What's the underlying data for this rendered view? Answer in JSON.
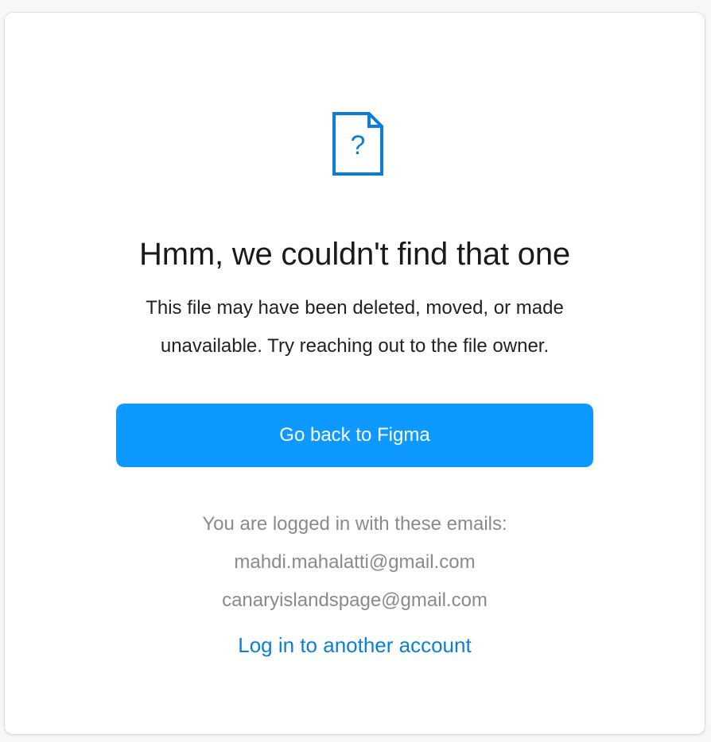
{
  "icon": {
    "name": "missing-file-icon",
    "glyph": "?",
    "color": "#0a7fd9"
  },
  "title": "Hmm, we couldn't find that one",
  "description": {
    "line1": "This file may have been deleted, moved, or made",
    "line2": "unavailable. Try reaching out to the file owner."
  },
  "primary_button": {
    "label": "Go back to Figma",
    "color": "#0d99ff"
  },
  "accounts": {
    "heading": "You are logged in with these emails:",
    "emails": [
      "mahdi.mahalatti@gmail.com",
      "canaryislandspage@gmail.com"
    ]
  },
  "login_link": {
    "label": "Log in to another account",
    "color": "#0a7fd9"
  }
}
